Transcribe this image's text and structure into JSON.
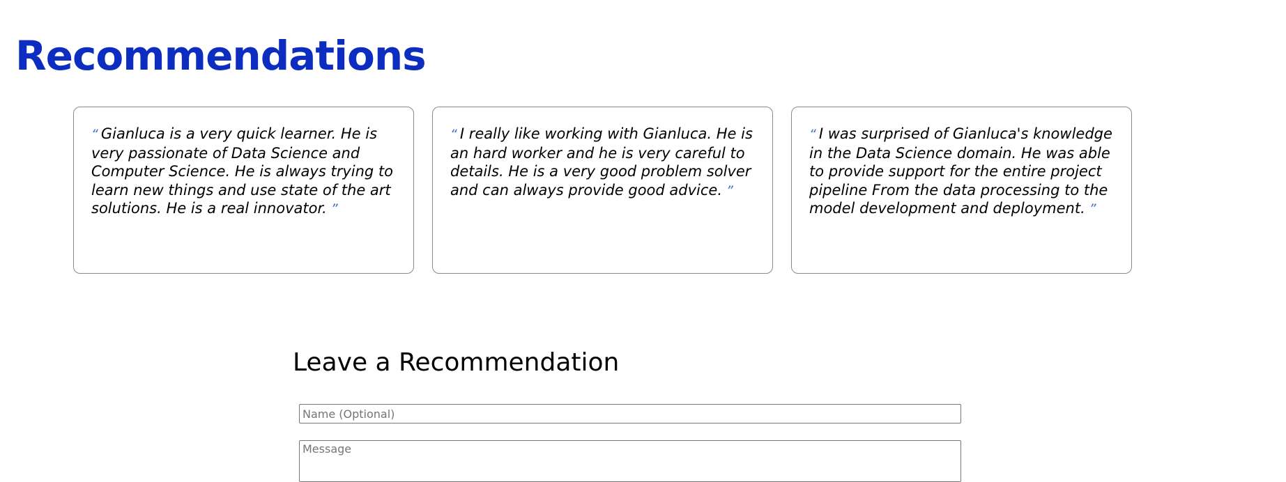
{
  "page": {
    "title": "Recommendations"
  },
  "colors": {
    "title": "#0c2dbf",
    "quote_mark": "#3d6fc4",
    "card_border": "#8a8a8a"
  },
  "recommendations": [
    {
      "open_quote": "“",
      "text": "Gianluca is a very quick learner. He is very passionate of Data Science and Computer Science. He is always trying to learn new things and use state of the art solutions. He is a real innovator.",
      "close_quote": "”"
    },
    {
      "open_quote": "“",
      "text": "I really like working with Gianluca. He is an hard worker and he is very careful to details. He is a very good problem solver and can always provide good advice.",
      "close_quote": "”"
    },
    {
      "open_quote": "“",
      "text": "I was surprised of Gianluca's knowledge in the Data Science domain. He was able to provide support for the entire project pipeline From the data processing to the model development and deployment.",
      "close_quote": "”"
    }
  ],
  "form": {
    "heading": "Leave a Recommendation",
    "name_placeholder": "Name (Optional)",
    "name_value": "",
    "message_placeholder": "Message",
    "message_value": ""
  }
}
